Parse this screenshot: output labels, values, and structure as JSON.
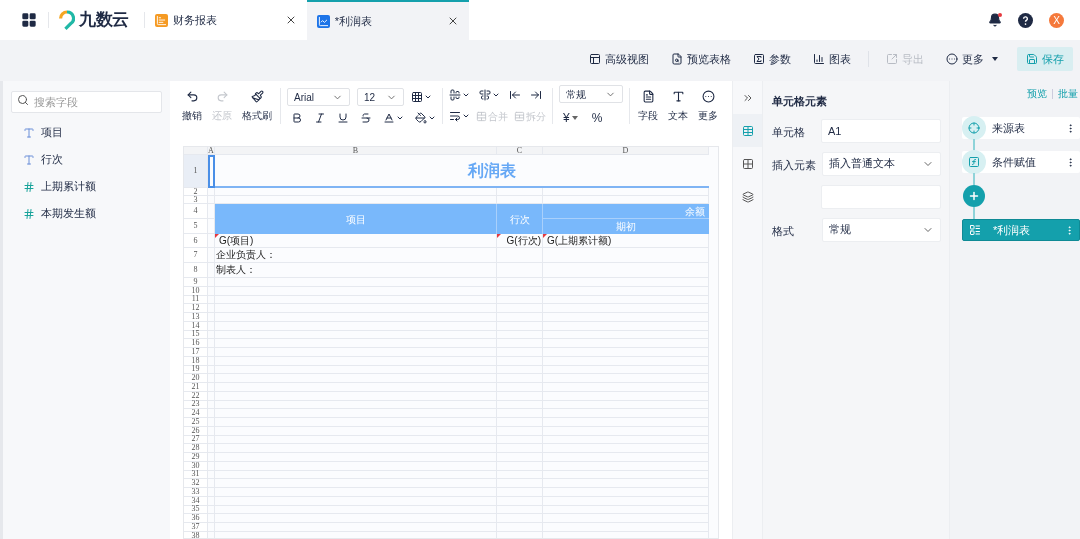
{
  "header": {
    "logo": "九数云",
    "tabs": [
      {
        "label": "财务报表",
        "kind": "report",
        "selected": false
      },
      {
        "label": "*利润表",
        "kind": "sheet",
        "selected": true
      }
    ],
    "notifications": {
      "unread": true
    },
    "avatar": "X"
  },
  "actions": [
    {
      "kind": "advanced",
      "label": "高级视图",
      "disabled": false
    },
    {
      "kind": "preview",
      "label": "预览表格",
      "disabled": false
    },
    {
      "kind": "params",
      "label": "参数",
      "disabled": false
    },
    {
      "kind": "chart",
      "label": "图表",
      "disabled": false
    },
    {
      "kind": "export",
      "label": "导出",
      "disabled": true
    },
    {
      "kind": "more",
      "label": "更多",
      "disabled": false
    },
    {
      "kind": "save",
      "label": "保存",
      "disabled": false
    }
  ],
  "fields": {
    "search": {
      "placeholder": "搜索字段"
    },
    "items": [
      {
        "kind": "text",
        "label": "项目"
      },
      {
        "kind": "text",
        "label": "行次"
      },
      {
        "kind": "number",
        "label": "上期累计额"
      },
      {
        "kind": "number",
        "label": "本期发生额"
      }
    ]
  },
  "toolbar": {
    "history": [
      {
        "kind": "undo",
        "label": "撤销",
        "disabled": false
      },
      {
        "kind": "redo",
        "label": "还原",
        "disabled": true
      },
      {
        "kind": "brush",
        "label": "格式刷",
        "disabled": false
      }
    ],
    "font": "Arial",
    "size": "12",
    "merge": [
      {
        "kind": "merge",
        "label": "合并",
        "disabled": true
      },
      {
        "kind": "split",
        "label": "拆分",
        "disabled": true
      }
    ],
    "number_format": "常规",
    "currency": "¥",
    "percent": "%",
    "insert": [
      {
        "kind": "field",
        "label": "字段"
      },
      {
        "kind": "text",
        "label": "文本"
      },
      {
        "kind": "more",
        "label": "更多"
      }
    ]
  },
  "sheet": {
    "columns": [
      "A",
      "B",
      "C",
      "D"
    ],
    "active_cell": {
      "selected": true
    },
    "title": "利润表",
    "header": {
      "item": "项目",
      "line_no": "行次",
      "balance": "余额",
      "opening": "期初"
    },
    "data_row": [
      "G(项目)",
      "G(行次)",
      "G(上期累计额)"
    ],
    "signers": [
      "企业负责人：",
      "制表人："
    ],
    "row_numbers": [
      "1",
      "2",
      "3",
      "4",
      "5",
      "6",
      "7",
      "8",
      "9",
      "10",
      "11",
      "12",
      "13",
      "14",
      "15",
      "16",
      "17",
      "18",
      "19",
      "20",
      "21",
      "22",
      "23",
      "24",
      "25",
      "26",
      "27",
      "28",
      "29",
      "30",
      "31",
      "32",
      "33",
      "34",
      "35",
      "36",
      "37",
      "38"
    ]
  },
  "side_tabs": [
    {
      "kind": "collapse",
      "selected": false
    },
    {
      "kind": "cell",
      "selected": true
    },
    {
      "kind": "layout",
      "selected": false
    },
    {
      "kind": "style",
      "selected": false
    }
  ],
  "properties": {
    "title": "单元格元素",
    "rows": [
      {
        "kind": "input",
        "label": "单元格",
        "value": "A1"
      },
      {
        "kind": "select",
        "label": "插入元素",
        "value": "插入普通文本"
      },
      {
        "kind": "input"
      },
      {
        "kind": "select",
        "label": "格式",
        "value": "常规"
      }
    ]
  },
  "flow": {
    "links": [
      "预览",
      "批量"
    ],
    "nodes": [
      {
        "kind": "source",
        "label": "来源表",
        "selected": false
      },
      {
        "kind": "formula",
        "label": "条件赋值",
        "selected": false
      },
      {
        "kind": "add"
      },
      {
        "kind": "output",
        "label": "*利润表",
        "selected": true
      }
    ]
  }
}
